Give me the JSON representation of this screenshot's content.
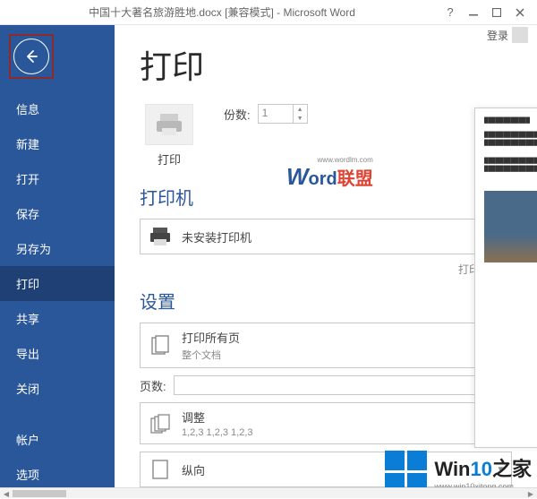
{
  "titlebar": {
    "title": "中国十大著名旅游胜地.docx [兼容模式] - Microsoft Word",
    "signin": "登录"
  },
  "sidebar": {
    "items": [
      {
        "label": "信息"
      },
      {
        "label": "新建"
      },
      {
        "label": "打开"
      },
      {
        "label": "保存"
      },
      {
        "label": "另存为"
      },
      {
        "label": "打印"
      },
      {
        "label": "共享"
      },
      {
        "label": "导出"
      },
      {
        "label": "关闭"
      },
      {
        "label": "帐户"
      },
      {
        "label": "选项"
      }
    ]
  },
  "content": {
    "page_title": "打印",
    "print_button": "打印",
    "copies_label": "份数:",
    "copies_value": "1",
    "printer_heading": "打印机",
    "printer_selected": "未安装打印机",
    "printer_props": "打印机属性",
    "settings_heading": "设置",
    "print_all": {
      "main": "打印所有页",
      "sub": "整个文档"
    },
    "pages_label": "页数:",
    "collate": {
      "main": "调整",
      "sub": "1,2,3    1,2,3    1,2,3"
    },
    "orientation": "纵向"
  },
  "watermarks": {
    "wordlm_url": "www.wordlm.com",
    "wordlm_cn": "联盟",
    "win10_url": "www.win10xitong.com",
    "win10_text": "Win10之家"
  }
}
